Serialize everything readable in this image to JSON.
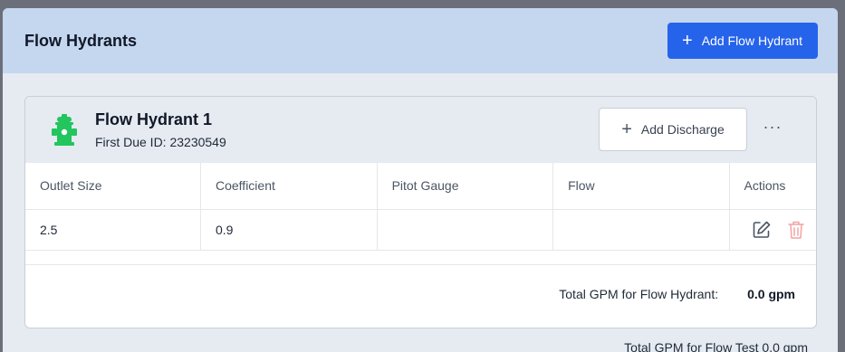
{
  "panel": {
    "title": "Flow Hydrants",
    "add_button": "Add Flow Hydrant"
  },
  "hydrant": {
    "name": "Flow Hydrant 1",
    "first_due": "First Due ID: 23230549",
    "add_discharge": "Add Discharge",
    "more_glyph": "···",
    "icon_color": "#22c55e",
    "columns": [
      "Outlet Size",
      "Coefficient",
      "Pitot Gauge",
      "Flow",
      "Actions"
    ],
    "rows": [
      {
        "outlet_size": "2.5",
        "coefficient": "0.9",
        "pitot_gauge": "",
        "flow": ""
      }
    ],
    "total_label": "Total GPM for Flow Hydrant:",
    "total_value": "0.0 gpm"
  },
  "footer": {
    "total_text": "Total GPM for Flow Test 0.0 gpm"
  },
  "colors": {
    "primary": "#2563eb",
    "header_bg": "#c5d6ef",
    "delete_icon": "#f3a3a3"
  }
}
